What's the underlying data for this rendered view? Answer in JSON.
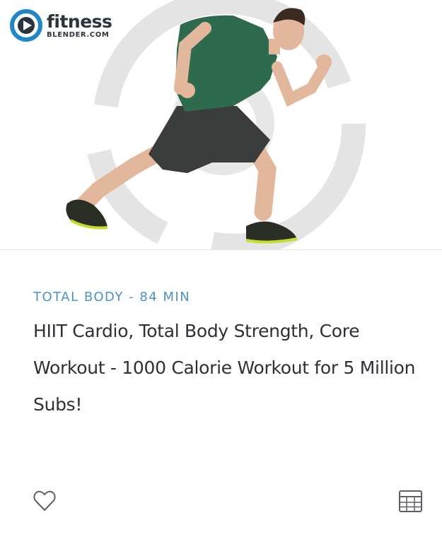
{
  "brand": {
    "name": "fitness",
    "sub": "BLENDER.COM"
  },
  "workout": {
    "category": "TOTAL BODY - 84 MIN",
    "title": "HIIT Cardio, Total Body Strength, Core Workout - 1000 Calorie Workout for 5 Million Subs!"
  },
  "icons": {
    "favorite": "heart-icon",
    "schedule": "calendar-icon",
    "logo": "fitness-blender-play-icon"
  },
  "colors": {
    "category": "#4a93c9",
    "title": "#2f2f3a",
    "logo_blue": "#1f86c8",
    "icon_stroke": "#5a5e6b"
  }
}
